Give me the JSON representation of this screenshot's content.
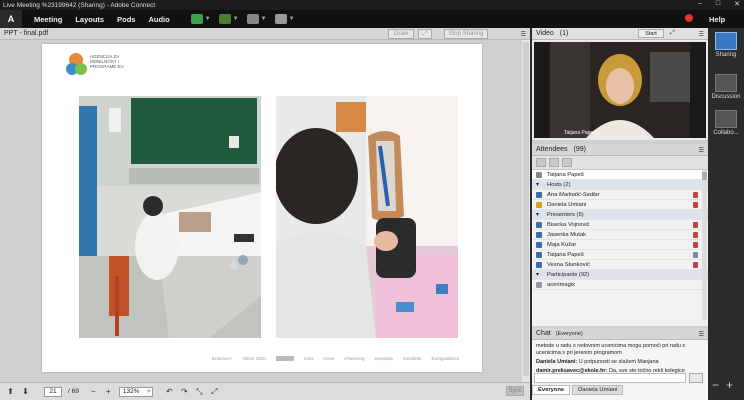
{
  "window": {
    "title": "Live Meeting %23199642 (Sharing) - Adobe Connect",
    "minimize": "–",
    "maximize": "□",
    "close": "✕"
  },
  "menubar": {
    "logo": "A",
    "items": [
      "Meeting",
      "Layouts",
      "Pods",
      "Audio"
    ],
    "help": "Help"
  },
  "share_pod": {
    "title": "PPT - final.pdf",
    "draw_label": "Draw",
    "stop_label": "Stop Sharing",
    "page_current": "21",
    "page_total": "/ 69",
    "zoom": "132%",
    "sync_label": "Sync"
  },
  "slide": {
    "logo_text": [
      "AGENCIJA ZA",
      "MOBILNOST I",
      "PROGRAME EU"
    ],
    "footer_logos": [
      "Erasmus+",
      "Obzor 2020",
      "",
      "cons",
      "ecvet",
      "eTwinning",
      "europass",
      "eurodesk",
      "Euroguidance"
    ]
  },
  "video_pod": {
    "title": "Video",
    "count": "(1)",
    "start_label": "Start",
    "speaker_name": "Tatjana Papeš"
  },
  "attendees_pod": {
    "title": "Attendees",
    "count": "(99)",
    "me": "Tatjana Papeš",
    "hosts_label": "Hosts (2)",
    "hosts": [
      "Ana Markotić-Sedlar",
      "Daniela Umiani"
    ],
    "presenters_label": "Presenters (5)",
    "presenters": [
      "Biserka Vojnović",
      "Jasenka Mutak",
      "Maja Kužar",
      "Tatjana Papeš",
      "Vesna Stunković"
    ],
    "participants_label": "Participants (92)",
    "participants": [
      "acerimagix"
    ]
  },
  "chat_pod": {
    "title": "Chat",
    "scope": "(Everyone)",
    "messages": [
      {
        "sender": "",
        "text": "metode u radu s redovnim ucenicima mogu pomoći pri radu s ucenicima s pri jerenim programom"
      },
      {
        "sender": "Daniela Umiani:",
        "text": "U potpunosti se slažem Manjana"
      },
      {
        "sender": "damir.preksavec@skole.hr:",
        "text": "Da, sve ste točno rekli kolegice Manjana !"
      }
    ],
    "tabs": [
      "Everyone",
      "Daniela Umiani"
    ]
  },
  "rail": {
    "items": [
      "Sharing",
      "Discussion",
      "Collabo..."
    ]
  },
  "colors": {
    "accent": "#3a77c2",
    "record": "#e2332d",
    "mic_muted": "#c74040"
  }
}
